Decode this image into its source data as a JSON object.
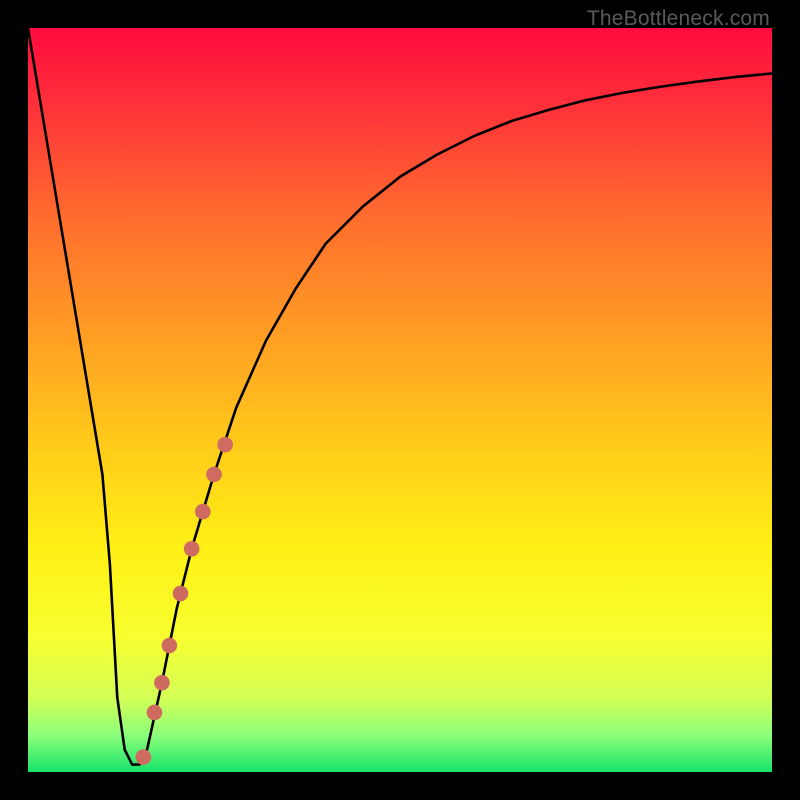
{
  "watermark": "TheBottleneck.com",
  "chart_data": {
    "type": "line",
    "title": "",
    "xlabel": "",
    "ylabel": "",
    "xlim": [
      0,
      100
    ],
    "ylim": [
      0,
      100
    ],
    "series": [
      {
        "name": "bottleneck-curve",
        "x": [
          0,
          2,
          4,
          6,
          8,
          10,
          11,
          12,
          13,
          14,
          15,
          16,
          18,
          20,
          22,
          25,
          28,
          32,
          36,
          40,
          45,
          50,
          55,
          60,
          65,
          70,
          75,
          80,
          85,
          90,
          95,
          100
        ],
        "values": [
          100,
          88,
          76,
          64,
          52,
          40,
          28,
          10,
          3,
          1,
          1,
          3,
          12,
          22,
          30,
          40,
          49,
          58,
          65,
          71,
          76,
          80,
          83,
          85.5,
          87.5,
          89,
          90.3,
          91.3,
          92.1,
          92.8,
          93.4,
          93.9
        ]
      }
    ],
    "markers": [
      {
        "name": "highlight-dot",
        "x": 15.5,
        "y": 2
      },
      {
        "name": "highlight-dot",
        "x": 17.0,
        "y": 8
      },
      {
        "name": "highlight-dot",
        "x": 18.0,
        "y": 12
      },
      {
        "name": "highlight-dot",
        "x": 19.0,
        "y": 17
      },
      {
        "name": "highlight-dot",
        "x": 20.5,
        "y": 24
      },
      {
        "name": "highlight-dot",
        "x": 22.0,
        "y": 30
      },
      {
        "name": "highlight-dot",
        "x": 23.5,
        "y": 35
      },
      {
        "name": "highlight-dot",
        "x": 25.0,
        "y": 40
      },
      {
        "name": "highlight-dot",
        "x": 26.5,
        "y": 44
      }
    ],
    "gradient_stops": [
      {
        "pos": 0.0,
        "color": "#ff0b3e"
      },
      {
        "pos": 0.1,
        "color": "#ff2f3a"
      },
      {
        "pos": 0.25,
        "color": "#ff6b2e"
      },
      {
        "pos": 0.4,
        "color": "#ff9a24"
      },
      {
        "pos": 0.55,
        "color": "#ffc81a"
      },
      {
        "pos": 0.7,
        "color": "#fff015"
      },
      {
        "pos": 0.82,
        "color": "#f7ff30"
      },
      {
        "pos": 0.9,
        "color": "#d4ff55"
      },
      {
        "pos": 0.95,
        "color": "#8dff7a"
      },
      {
        "pos": 1.0,
        "color": "#17e36b"
      }
    ],
    "curve_color": "#000000",
    "marker_color": "#cf6a60"
  }
}
